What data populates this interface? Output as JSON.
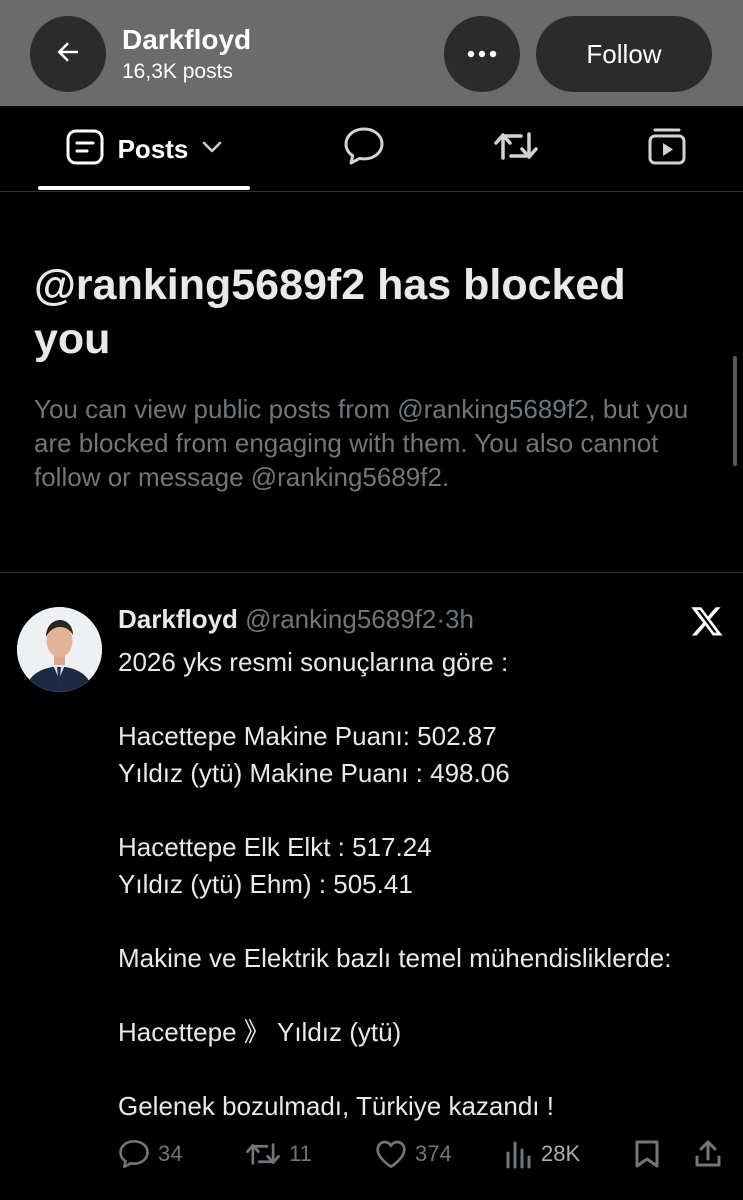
{
  "header": {
    "title": "Darkfloyd",
    "subtitle": "16,3K posts",
    "follow_label": "Follow",
    "icons": [
      "arrow-left-icon",
      "more-icon"
    ]
  },
  "tabs": {
    "posts_label": "Posts",
    "icons": [
      "posts-icon",
      "chevron-down-icon",
      "reply-icon",
      "repost-icon",
      "media-icon"
    ]
  },
  "blocked": {
    "title": "@ranking5689f2 has blocked you",
    "description": "You can view public posts from @ranking5689f2, but you are blocked from engaging with them. You also cannot follow or message @ranking5689f2."
  },
  "post": {
    "author_name": "Darkfloyd",
    "author_handle": "@ranking5689f2",
    "separator": "·",
    "time": "3h",
    "lines": [
      "2026 yks resmi sonuçlarına göre :",
      "",
      "Hacettepe Makine  Puanı: 502.87",
      "Yıldız (ytü) Makine Puanı : 498.06",
      "",
      "Hacettepe Elk Elkt : 517.24",
      "Yıldız (ytü) Ehm) : 505.41",
      "",
      "Makine ve Elektrik bazlı temel mühendisliklerde:",
      "",
      "Hacettepe 》 Yıldız (ytü)",
      "",
      "Gelenek bozulmadı, Türkiye kazandı !"
    ],
    "stats": {
      "replies": "34",
      "reposts": "11",
      "likes": "374",
      "views": "28K"
    }
  },
  "colors": {
    "header_bg": "#6b6b6b",
    "button_bg": "#2b2b2b",
    "background": "#000000",
    "text_primary": "#e7e9ea",
    "text_secondary": "#71767b",
    "divider": "#2f3336"
  }
}
